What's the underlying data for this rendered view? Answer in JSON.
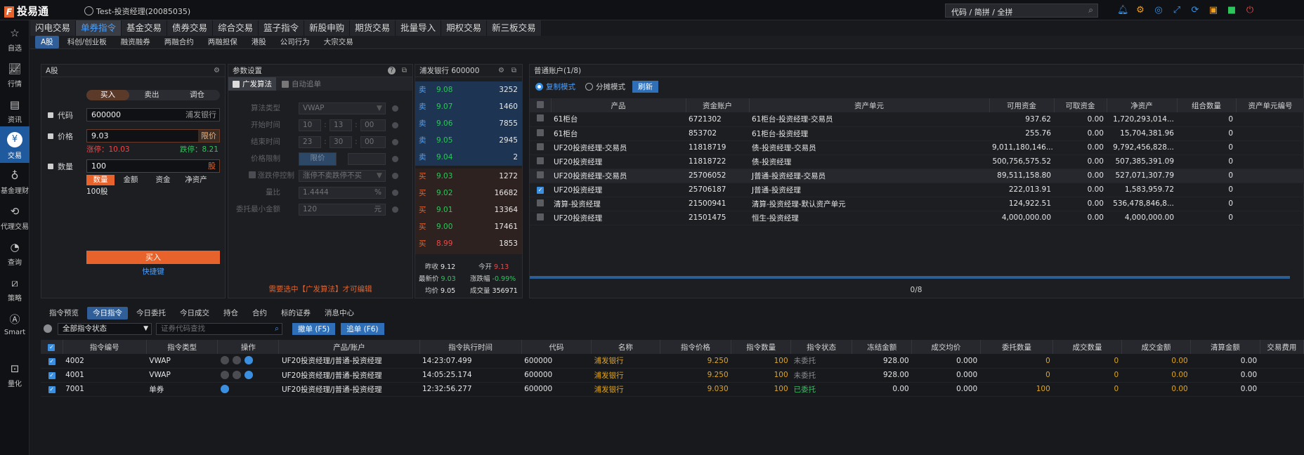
{
  "app": {
    "name": "投易通",
    "user": "Test-投资经理(20085035)"
  },
  "search": {
    "placeholder": "代码 / 简拼 / 全拼"
  },
  "top_icons": [
    "bell-icon",
    "gear-icon",
    "refresh-chat-icon",
    "expand-icon",
    "sync-icon",
    "window-icon",
    "lock-icon",
    "power-icon"
  ],
  "left_nav": [
    {
      "label": "自选",
      "icon": "star-icon"
    },
    {
      "label": "行情",
      "icon": "chart-line-icon"
    },
    {
      "label": "资讯",
      "icon": "news-icon"
    },
    {
      "label": "交易",
      "icon": "yen-icon",
      "active": true
    },
    {
      "label": "基金理财",
      "icon": "moneybag-icon"
    },
    {
      "label": "代理交易",
      "icon": "yen-cycle-icon"
    },
    {
      "label": "查询",
      "icon": "pie-icon"
    },
    {
      "label": "策略",
      "icon": "strategy-icon"
    },
    {
      "label": "Smart",
      "icon": "ai-icon"
    },
    {
      "label": "量化",
      "icon": "quant-icon"
    }
  ],
  "main_tabs": [
    "闪电交易",
    "单券指令",
    "基金交易",
    "债券交易",
    "综合交易",
    "篮子指令",
    "新股申购",
    "期货交易",
    "批量导入",
    "期权交易",
    "新三板交易"
  ],
  "main_tab_active": "单券指令",
  "sub_tabs": [
    "A股",
    "科创/创业板",
    "融资融券",
    "两融合约",
    "两融担保",
    "港股",
    "公司行为",
    "大宗交易"
  ],
  "order_panel": {
    "title": "A股",
    "sides": [
      "买入",
      "卖出",
      "调仓"
    ],
    "code_label": "代码",
    "code_value": "600000",
    "code_name": "浦发银行",
    "price_label": "价格",
    "price_value": "9.03",
    "price_type": "限价",
    "limit_up": "涨停：10.03",
    "limit_down": "跌停：8.21",
    "qty_label": "数量",
    "qty_value": "100",
    "qty_unit": "股",
    "qty_modes": [
      "数量",
      "金额",
      "资金",
      "净资产"
    ],
    "qty_summary": "100股",
    "submit": "买入",
    "shortcut": "快捷键"
  },
  "param_panel": {
    "title": "参数设置",
    "opt_algo": "广发算法",
    "opt_auto": "自动追单",
    "algo_type_label": "算法类型",
    "algo_type": "VWAP",
    "start_label": "开始时间",
    "start": [
      "10",
      "13",
      "00"
    ],
    "end_label": "结束时间",
    "end": [
      "23",
      "30",
      "00"
    ],
    "price_limit_label": "价格限制",
    "price_limit_btn": "限价",
    "limit_ctrl_label": "涨跌停控制",
    "limit_ctrl_value": "涨停不卖跌停不买",
    "volume_ratio_label": "量比",
    "volume_ratio": "1.4444",
    "volume_ratio_unit": "%",
    "min_amt_label": "委托最小金额",
    "min_amt": "120",
    "min_amt_unit": "元",
    "notice": "需要选中【广发算法】才可编辑"
  },
  "depth": {
    "title": "浦发银行 600000",
    "asks": [
      {
        "side": "卖",
        "price": "9.08",
        "vol": "3252"
      },
      {
        "side": "卖",
        "price": "9.07",
        "vol": "1460"
      },
      {
        "side": "卖",
        "price": "9.06",
        "vol": "7855"
      },
      {
        "side": "卖",
        "price": "9.05",
        "vol": "2945"
      },
      {
        "side": "卖",
        "price": "9.04",
        "vol": "2"
      }
    ],
    "bids": [
      {
        "side": "买",
        "price": "9.03",
        "vol": "1272"
      },
      {
        "side": "买",
        "price": "9.02",
        "vol": "16682"
      },
      {
        "side": "买",
        "price": "9.01",
        "vol": "13364"
      },
      {
        "side": "买",
        "price": "9.00",
        "vol": "17461"
      },
      {
        "side": "买",
        "price": "8.99",
        "vol": "1853"
      }
    ],
    "stats": {
      "prev_close_label": "昨收",
      "prev_close": "9.12",
      "open_label": "今开",
      "open": "9.13",
      "last_label": "最新价",
      "last": "9.03",
      "chg_label": "涨跌幅",
      "chg": "-0.99%",
      "avg_label": "均价",
      "avg": "9.05",
      "volume_label": "成交量",
      "volume": "356971"
    }
  },
  "accounts": {
    "title": "普通账户(1/8)",
    "mode_copy": "复制模式",
    "mode_split": "分摊模式",
    "refresh": "刷新",
    "columns": [
      "产品",
      "资金账户",
      "资产单元",
      "可用资金",
      "可取资金",
      "净资产",
      "组合数量",
      "资产单元编号"
    ],
    "rows": [
      {
        "checked": false,
        "product": "61柜台",
        "acct": "6721302",
        "unit": "61柜台-投资经理-交易员",
        "avail": "937.62",
        "withdraw": "0.00",
        "net": "1,720,293,014...",
        "count": "0"
      },
      {
        "checked": false,
        "product": "61柜台",
        "acct": "853702",
        "unit": "61柜台-投资经理",
        "avail": "255.76",
        "withdraw": "0.00",
        "net": "15,704,381.96",
        "count": "0"
      },
      {
        "checked": false,
        "product": "UF20投资经理-交易员",
        "acct": "11818719",
        "unit": "债-投资经理-交易员",
        "avail": "9,011,180,146...",
        "withdraw": "0.00",
        "net": "9,792,456,828...",
        "count": "0"
      },
      {
        "checked": false,
        "product": "UF20投资经理",
        "acct": "11818722",
        "unit": "债-投资经理",
        "avail": "500,756,575.52",
        "withdraw": "0.00",
        "net": "507,385,391.09",
        "count": "0"
      },
      {
        "checked": false,
        "product": "UF20投资经理-交易员",
        "acct": "25706052",
        "unit": "J普通-投资经理-交易员",
        "avail": "89,511,158.80",
        "withdraw": "0.00",
        "net": "527,071,307.79",
        "count": "0"
      },
      {
        "checked": true,
        "product": "UF20投资经理",
        "acct": "25706187",
        "unit": "J普通-投资经理",
        "avail": "222,013.91",
        "withdraw": "0.00",
        "net": "1,583,959.72",
        "count": "0"
      },
      {
        "checked": false,
        "product": "清算-投资经理",
        "acct": "21500941",
        "unit": "清算-投资经理-默认资产单元",
        "avail": "124,922.51",
        "withdraw": "0.00",
        "net": "536,478,846,8...",
        "count": "0"
      },
      {
        "checked": false,
        "product": "UF20投资经理",
        "acct": "21501475",
        "unit": "恒生-投资经理",
        "avail": "4,000,000.00",
        "withdraw": "0.00",
        "net": "4,000,000.00",
        "count": "0"
      }
    ],
    "footer": "0/8"
  },
  "bottom_tabs": [
    "指令预览",
    "今日指令",
    "今日委托",
    "今日成交",
    "持仓",
    "合约",
    "标的证券",
    "消息中心"
  ],
  "bottom_tab_active": "今日指令",
  "filter": {
    "status": "全部指令状态",
    "code_placeholder": "证券代码查找",
    "cancel": "撤单 (F5)",
    "chase": "追单 (F6)"
  },
  "orders": {
    "columns": [
      "指令编号",
      "指令类型",
      "操作",
      "产品/账户",
      "指令执行时间",
      "代码",
      "名称",
      "指令价格",
      "指令数量",
      "指令状态",
      "冻结金额",
      "成交均价",
      "委托数量",
      "成交数量",
      "成交金额",
      "清算金额",
      "交易费用"
    ],
    "rows": [
      {
        "id": "4002",
        "type": "VWAP",
        "account": "UF20投资经理/J普通-投资经理",
        "time": "14:23:07.499",
        "code": "600000",
        "name": "浦发银行",
        "price": "9.250",
        "qty": "100",
        "status": "未委托",
        "frozen": "928.00",
        "avg": "0.000",
        "entrust": "0",
        "filled": "0",
        "amount": "0.00",
        "settle": "0.00"
      },
      {
        "id": "4001",
        "type": "VWAP",
        "account": "UF20投资经理/J普通-投资经理",
        "time": "14:05:25.174",
        "code": "600000",
        "name": "浦发银行",
        "price": "9.250",
        "qty": "100",
        "status": "未委托",
        "frozen": "928.00",
        "avg": "0.000",
        "entrust": "0",
        "filled": "0",
        "amount": "0.00",
        "settle": "0.00"
      },
      {
        "id": "7001",
        "type": "单券",
        "account": "UF20投资经理/J普通-投资经理",
        "time": "12:32:56.277",
        "code": "600000",
        "name": "浦发银行",
        "price": "9.030",
        "qty": "100",
        "status": "已委托",
        "frozen": "0.00",
        "avg": "0.000",
        "entrust": "100",
        "filled": "0",
        "amount": "0.00",
        "settle": "0.00"
      }
    ]
  },
  "colors": {
    "accent": "#3b8fe0",
    "buy": "#e8632b",
    "up": "#e84a4a",
    "down": "#2ec45c",
    "gold": "#e0a423"
  }
}
